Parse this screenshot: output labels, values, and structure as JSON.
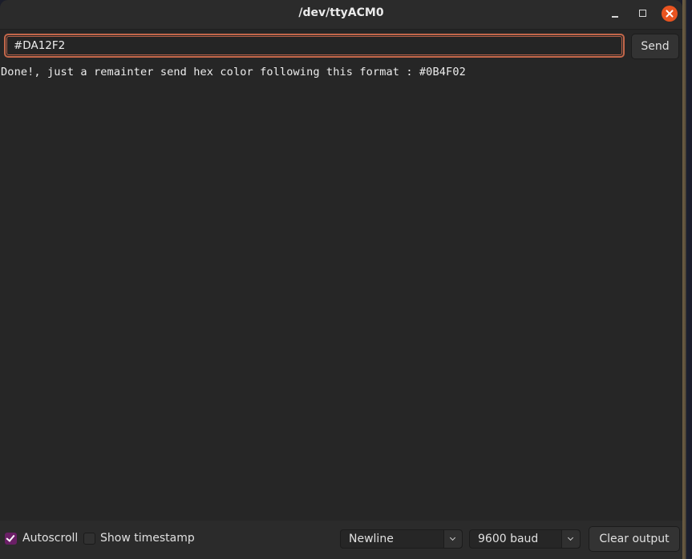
{
  "window": {
    "title": "/dev/ttyACM0",
    "controls": [
      "minimize",
      "maximize",
      "close"
    ]
  },
  "input_bar": {
    "value": "#DA12F2",
    "send_label": "Send"
  },
  "output": {
    "lines": [
      "Done!, just a remainter send hex color following this format : #0B4F02"
    ]
  },
  "footer": {
    "autoscroll": {
      "label": "Autoscroll",
      "checked": true
    },
    "show_timestamp": {
      "label": "Show timestamp",
      "checked": false
    },
    "line_ending": {
      "selected": "Newline"
    },
    "baud_rate": {
      "selected": "9600 baud"
    },
    "clear_label": "Clear output"
  },
  "colors": {
    "accent_focus": "#c4674a",
    "checkbox_checked": "#6a1f66",
    "close_button": "#e95420"
  }
}
